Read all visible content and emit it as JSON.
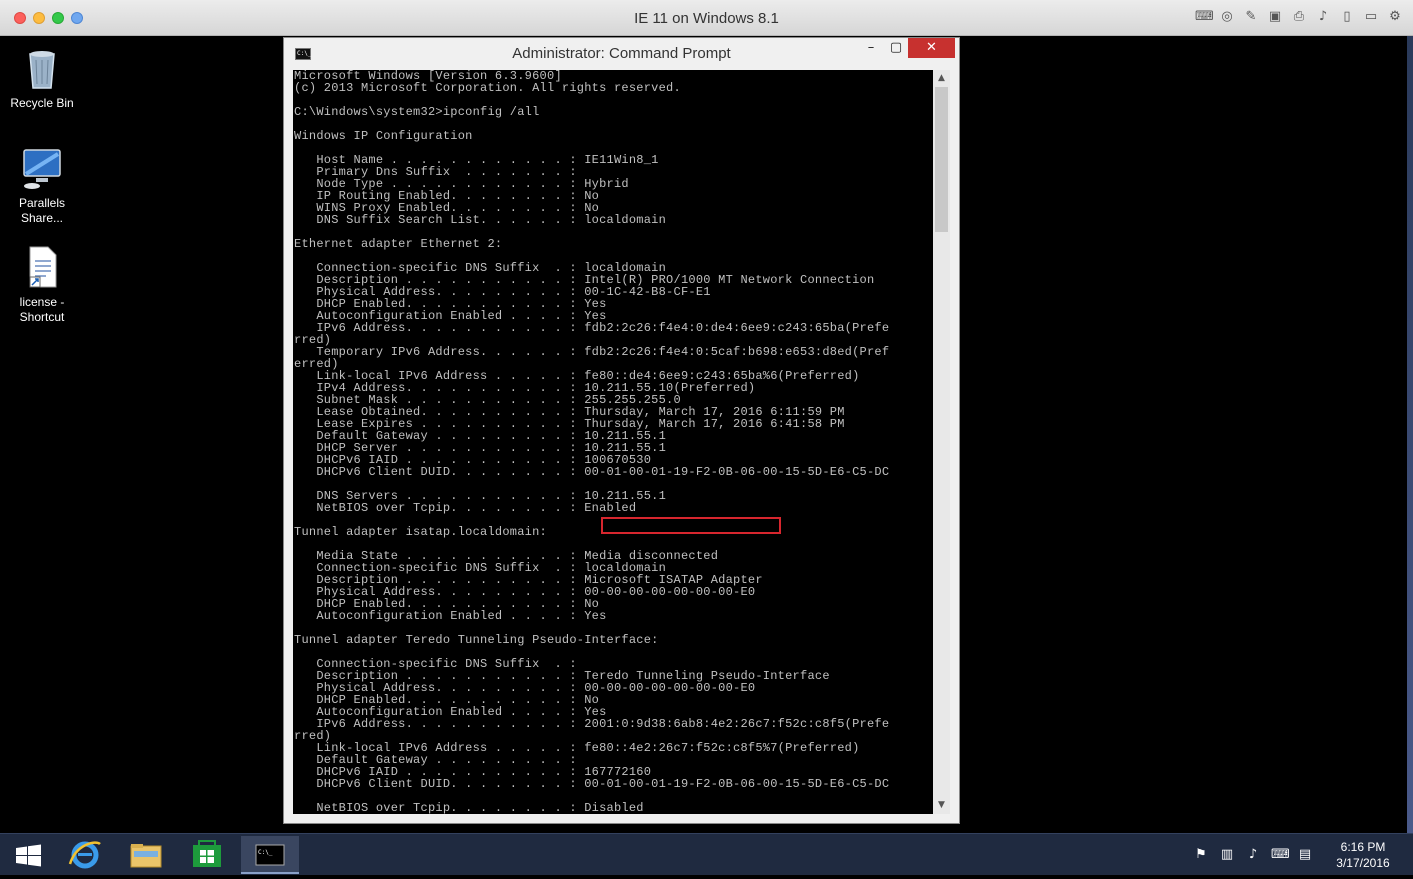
{
  "host": {
    "title": "IE 11 on Windows 8.1",
    "toolbar_icons": [
      "keyboard-icon",
      "settings-icon",
      "tools-icon",
      "device-icon",
      "print-icon",
      "volume-icon",
      "usb-icon",
      "display-icon",
      "gear-icon"
    ]
  },
  "desktop": {
    "icons": [
      {
        "label": "Recycle Bin",
        "icon": "recycle-bin-icon"
      },
      {
        "label": "Parallels Share...",
        "icon": "parallels-share-icon"
      },
      {
        "label": "license - Shortcut",
        "icon": "document-shortcut-icon"
      }
    ]
  },
  "cmd": {
    "title": "Administrator: Command Prompt",
    "minimize": "–",
    "maximize": "▢",
    "close": "✕",
    "output": "Microsoft Windows [Version 6.3.9600]\n(c) 2013 Microsoft Corporation. All rights reserved.\n\nC:\\Windows\\system32>ipconfig /all\n\nWindows IP Configuration\n\n   Host Name . . . . . . . . . . . . : IE11Win8_1\n   Primary Dns Suffix  . . . . . . . :\n   Node Type . . . . . . . . . . . . : Hybrid\n   IP Routing Enabled. . . . . . . . : No\n   WINS Proxy Enabled. . . . . . . . : No\n   DNS Suffix Search List. . . . . . : localdomain\n\nEthernet adapter Ethernet 2:\n\n   Connection-specific DNS Suffix  . : localdomain\n   Description . . . . . . . . . . . : Intel(R) PRO/1000 MT Network Connection\n   Physical Address. . . . . . . . . : 00-1C-42-B8-CF-E1\n   DHCP Enabled. . . . . . . . . . . : Yes\n   Autoconfiguration Enabled . . . . : Yes\n   IPv6 Address. . . . . . . . . . . : fdb2:2c26:f4e4:0:de4:6ee9:c243:65ba(Prefe\nrred)\n   Temporary IPv6 Address. . . . . . : fdb2:2c26:f4e4:0:5caf:b698:e653:d8ed(Pref\nerred)\n   Link-local IPv6 Address . . . . . : fe80::de4:6ee9:c243:65ba%6(Preferred)\n   IPv4 Address. . . . . . . . . . . : 10.211.55.10(Preferred)\n   Subnet Mask . . . . . . . . . . . : 255.255.255.0\n   Lease Obtained. . . . . . . . . . : Thursday, March 17, 2016 6:11:59 PM\n   Lease Expires . . . . . . . . . . : Thursday, March 17, 2016 6:41:58 PM\n   Default Gateway . . . . . . . . . : 10.211.55.1\n   DHCP Server . . . . . . . . . . . : 10.211.55.1\n   DHCPv6 IAID . . . . . . . . . . . : 100670530\n   DHCPv6 Client DUID. . . . . . . . : 00-01-00-01-19-F2-0B-06-00-15-5D-E6-C5-DC\n\n   DNS Servers . . . . . . . . . . . : 10.211.55.1\n   NetBIOS over Tcpip. . . . . . . . : Enabled\n\nTunnel adapter isatap.localdomain:\n\n   Media State . . . . . . . . . . . : Media disconnected\n   Connection-specific DNS Suffix  . : localdomain\n   Description . . . . . . . . . . . : Microsoft ISATAP Adapter\n   Physical Address. . . . . . . . . : 00-00-00-00-00-00-00-E0\n   DHCP Enabled. . . . . . . . . . . : No\n   Autoconfiguration Enabled . . . . : Yes\n\nTunnel adapter Teredo Tunneling Pseudo-Interface:\n\n   Connection-specific DNS Suffix  . :\n   Description . . . . . . . . . . . : Teredo Tunneling Pseudo-Interface\n   Physical Address. . . . . . . . . : 00-00-00-00-00-00-00-E0\n   DHCP Enabled. . . . . . . . . . . : No\n   Autoconfiguration Enabled . . . . : Yes\n   IPv6 Address. . . . . . . . . . . : 2001:0:9d38:6ab8:4e2:26c7:f52c:c8f5(Prefe\nrred)\n   Link-local IPv6 Address . . . . . : fe80::4e2:26c7:f52c:c8f5%7(Preferred)\n   Default Gateway . . . . . . . . . :\n   DHCPv6 IAID . . . . . . . . . . . : 167772160\n   DHCPv6 Client DUID. . . . . . . . : 00-01-00-01-19-F2-0B-06-00-15-5D-E6-C5-DC\n\n   NetBIOS over Tcpip. . . . . . . . : Disabled"
  },
  "taskbar": {
    "items": [
      "start-icon",
      "internet-explorer-icon",
      "file-explorer-icon",
      "store-icon",
      "command-prompt-icon"
    ],
    "tray_icons": [
      "action-center-icon",
      "network-icon",
      "volume-icon",
      "language-icon",
      "notification-icon"
    ],
    "time": "6:16 PM",
    "date": "3/17/2016"
  }
}
